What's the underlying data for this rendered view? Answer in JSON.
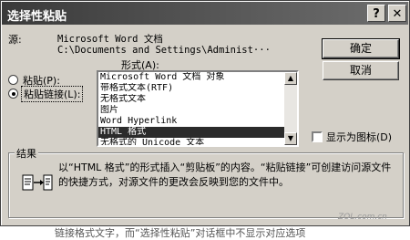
{
  "dialog": {
    "title": "选择性粘贴",
    "help_glyph": "?",
    "close_glyph": "✕"
  },
  "source": {
    "label": "源:",
    "line1": "Microsoft Word 文档",
    "line2": "C:\\Documents and Settings\\Administ···"
  },
  "buttons": {
    "ok": "确定",
    "cancel": "取消"
  },
  "options": {
    "paste": "粘贴(P):",
    "paste_link": "粘贴链接(L):",
    "selected": "paste_link"
  },
  "format": {
    "label": "形式(A):",
    "items": [
      "Microsoft Word 文档 对象",
      "带格式文本(RTF)",
      "无格式文本",
      "图片",
      "Word Hyperlink",
      "HTML 格式",
      "无格式的 Unicode 文本"
    ],
    "selected_index": 5
  },
  "display_as_icon": {
    "label": "显示为图标(D)",
    "checked": false
  },
  "result": {
    "title": "结果",
    "text": "以“HTML 格式”的形式插入“剪贴板”的内容。“粘贴链接”可创建访问源文件的快捷方式，对源文件的更改会反映到您的文件中。"
  },
  "watermark": "ZOL.com.cn",
  "below_text": "链接格式文字，而“选择性粘贴”对话框中不显示对应选项"
}
